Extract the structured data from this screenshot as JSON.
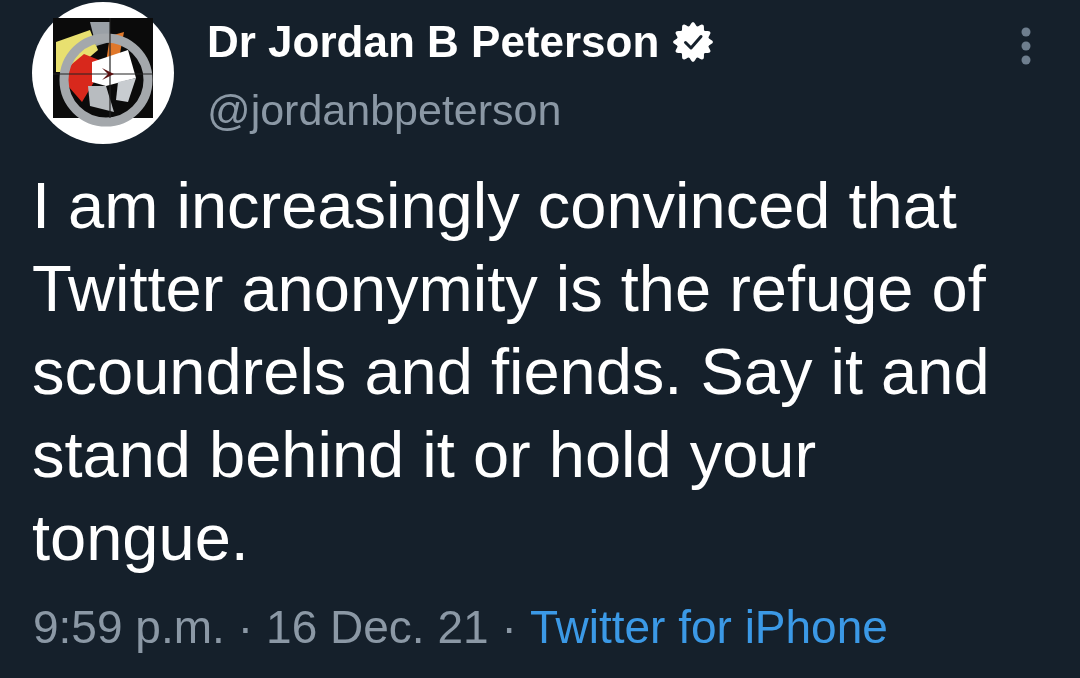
{
  "tweet": {
    "author": {
      "name": "Dr Jordan B Peterson",
      "verified": true,
      "handle": "@jordanbpeterson"
    },
    "text": "I am increasingly convinced that Twitter anonymity is the refuge of scoundrels and fiends. Say it and stand behind it or hold your tongue.",
    "meta": [
      {
        "kind": "time",
        "text": "9:59 p.m."
      },
      {
        "kind": "separator",
        "text": "·"
      },
      {
        "kind": "date",
        "text": "16 Dec. 21"
      },
      {
        "kind": "separator",
        "text": "·"
      },
      {
        "kind": "source",
        "text": "Twitter for iPhone"
      }
    ]
  }
}
